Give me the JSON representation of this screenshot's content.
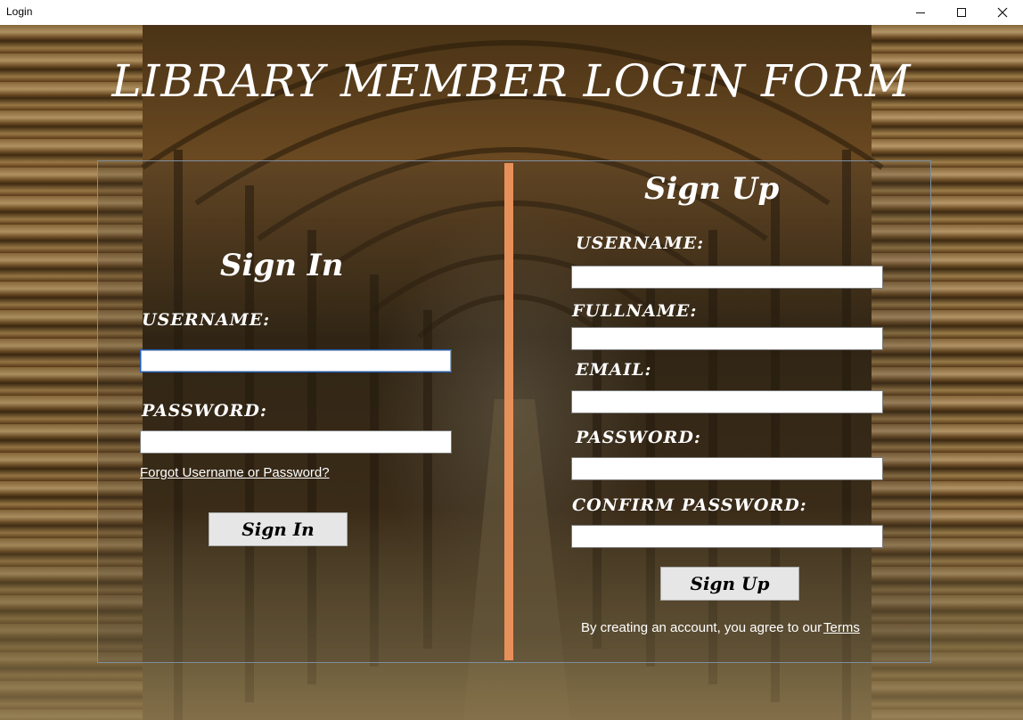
{
  "window": {
    "title": "Login",
    "minimize_icon": "minimize-icon",
    "maximize_icon": "maximize-icon",
    "close_icon": "close-icon"
  },
  "heading": "LIBRARY MEMBER LOGIN FORM",
  "sign_in": {
    "title": "Sign In",
    "username_label": "USERNAME:",
    "username_value": "",
    "password_label": "PASSWORD:",
    "password_value": "",
    "forgot_link": "Forgot Username or Password?",
    "button_label": "Sign In"
  },
  "sign_up": {
    "title": "Sign Up",
    "username_label": "USERNAME:",
    "username_value": "",
    "fullname_label": "FULLNAME:",
    "fullname_value": "",
    "email_label": "EMAIL:",
    "email_value": "",
    "password_label": "PASSWORD:",
    "password_value": "",
    "confirm_password_label": "CONFIRM PASSWORD:",
    "confirm_password_value": "",
    "button_label": "Sign Up",
    "terms_note": "By creating an account, you agree to our",
    "terms_link": "Terms"
  },
  "colors": {
    "divider": "#e8905a",
    "text": "#ffffff"
  }
}
